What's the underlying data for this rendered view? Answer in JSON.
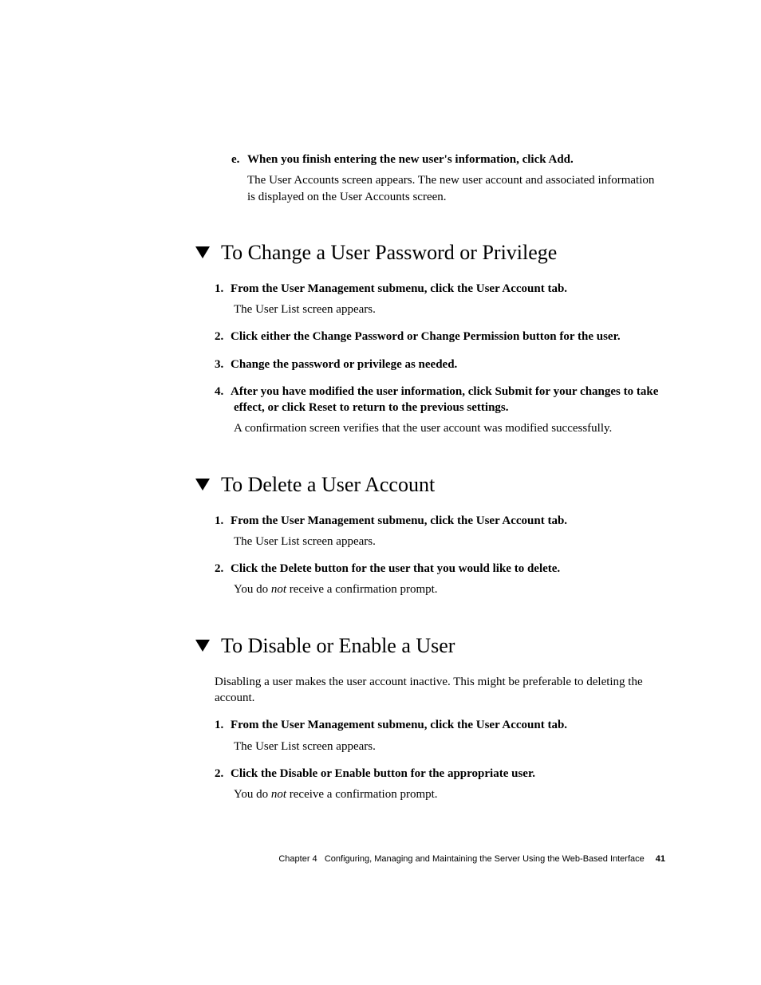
{
  "stepE": {
    "marker": "e.",
    "bold": "When you finish entering the new user's information, click Add.",
    "body": "The User Accounts screen appears. The new user account and associated information is displayed on the User Accounts screen."
  },
  "sections": {
    "change": {
      "title": "To Change a User Password or Privilege",
      "steps": [
        {
          "num": "1.",
          "bold": "From the User Management submenu, click the User Account tab.",
          "body": "The User List screen appears."
        },
        {
          "num": "2.",
          "bold": "Click either the Change Password or Change Permission button for the user."
        },
        {
          "num": "3.",
          "bold": "Change the password or privilege as needed."
        },
        {
          "num": "4.",
          "bold": "After you have modified the user information, click Submit for your changes to take effect, or click Reset to return to the previous settings.",
          "body": "A confirmation screen verifies that the user account was modified successfully."
        }
      ]
    },
    "delete": {
      "title": "To Delete a User Account",
      "steps": [
        {
          "num": "1.",
          "bold": "From the User Management submenu, click the User Account tab.",
          "body": "The User List screen appears."
        },
        {
          "num": "2.",
          "bold": "Click the Delete button for the user that you would like to delete.",
          "body_pre": "You do ",
          "body_em": "not",
          "body_post": " receive a confirmation prompt."
        }
      ]
    },
    "disable": {
      "title": "To Disable or Enable a User",
      "intro": "Disabling a user makes the user account inactive. This might be preferable to deleting the account.",
      "steps": [
        {
          "num": "1.",
          "bold": "From the User Management submenu, click the User Account tab.",
          "body": "The User List screen appears."
        },
        {
          "num": "2.",
          "bold": "Click the Disable or Enable button for the appropriate user.",
          "body_pre": "You do ",
          "body_em": "not",
          "body_post": " receive a confirmation prompt."
        }
      ]
    }
  },
  "footer": {
    "chapter": "Chapter 4",
    "title": "Configuring, Managing and Maintaining the Server Using the Web-Based Interface",
    "page": "41"
  }
}
